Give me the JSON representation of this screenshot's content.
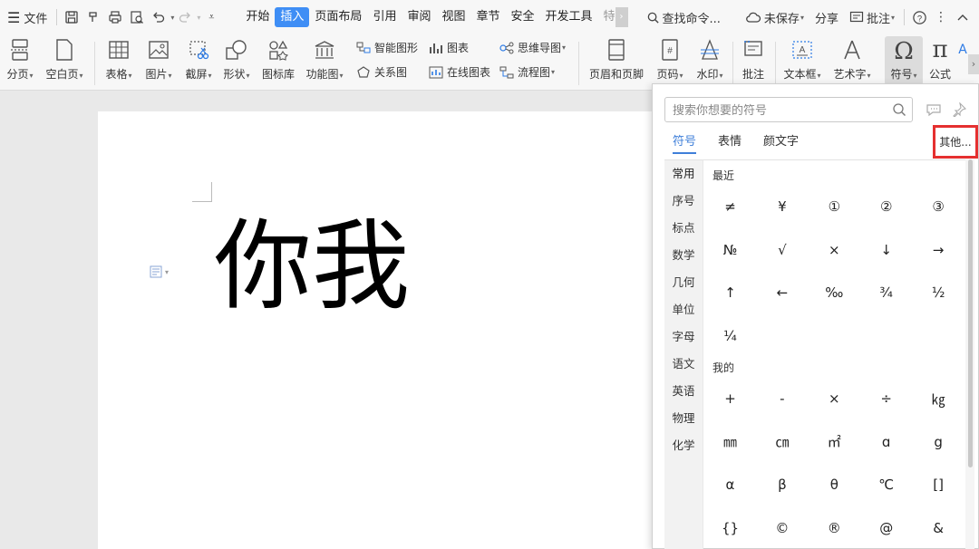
{
  "menubar": {
    "file_label": "文件",
    "tabs": [
      "开始",
      "插入",
      "页面布局",
      "引用",
      "审阅",
      "视图",
      "章节",
      "安全",
      "开发工具",
      "特"
    ],
    "active_tab": "插入",
    "search_label": "查找命令...",
    "unsaved_label": "未保存",
    "share_label": "分享",
    "comment_label": "批注"
  },
  "ribbon": {
    "page_break": "分页",
    "blank_page": "空白页",
    "table": "表格",
    "picture": "图片",
    "screenshot": "截屏",
    "shape": "形状",
    "icon_lib": "图标库",
    "function_chart": "功能图",
    "smart_shape": "智能图形",
    "chart": "图表",
    "mindmap": "思维导图",
    "relation": "关系图",
    "online_chart": "在线图表",
    "flowchart": "流程图",
    "header_footer": "页眉和页脚",
    "page_number": "页码",
    "watermark": "水印",
    "comment": "批注",
    "textbox": "文本框",
    "wordart": "艺术字",
    "symbol": "符号",
    "formula": "公式"
  },
  "document": {
    "text": "你我"
  },
  "symbol_panel": {
    "search_placeholder": "搜索你想要的符号",
    "tabs": [
      "符号",
      "表情",
      "颜文字"
    ],
    "active_tab": "符号",
    "other_button": "其他...",
    "categories": [
      "常用",
      "序号",
      "标点",
      "数学",
      "几何",
      "单位",
      "字母",
      "语文",
      "英语",
      "物理",
      "化学"
    ],
    "active_category": "常用",
    "recent_title": "最近",
    "recent_symbols": [
      "≠",
      "¥",
      "①",
      "②",
      "③",
      "№",
      "√",
      "×",
      "↓",
      "→",
      "↑",
      "←",
      "‰",
      "¾",
      "½",
      "¼"
    ],
    "mine_title": "我的",
    "mine_symbols": [
      "+",
      "-",
      "×",
      "÷",
      "㎏",
      "㎜",
      "㎝",
      "㎡",
      "ɑ",
      "g",
      "α",
      "β",
      "θ",
      "℃",
      "[]",
      "{}",
      "©",
      "®",
      "@",
      "&"
    ]
  },
  "colors": {
    "accent": "#3f8ef5",
    "highlight_box": "#e53030",
    "active_tab_text": "#3f7fd9"
  }
}
